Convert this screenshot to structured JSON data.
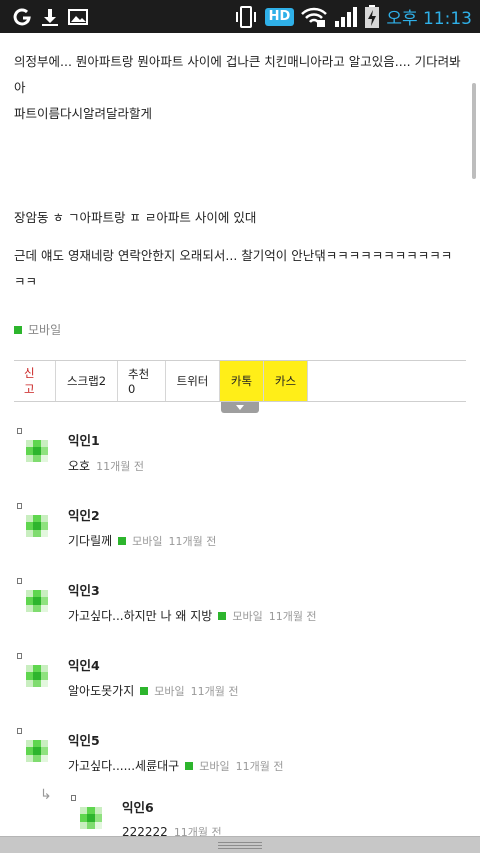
{
  "status_bar": {
    "clock": "오후 11:13",
    "hd_badge": "HD",
    "icons": [
      "app-icon",
      "download-icon",
      "image-icon",
      "vibrate-icon",
      "wifi-icon",
      "signal-icon",
      "battery-charging-icon"
    ]
  },
  "post": {
    "line1": "의정부에... 뭔아파트랑 뭔아파트 사이에 겁나큰 치킨매니아라고 알고있음.... 기다려봐 아",
    "line2": "파트이름다시알려달라할게",
    "line3": "장암동 ㅎ ㄱ아파트랑 ㅍ ㄹ아파트 사이에 있대",
    "line4": "근데 얘도 영재네랑 연락안한지 오래되서... 찰기억이 안난댂ㅋㅋㅋㅋㅋㅋㅋㅋㅋㅋㅋ",
    "line5": "ㅋㅋ",
    "source": "모바일"
  },
  "actions": {
    "report": "신고",
    "scrap": "스크랩2",
    "recommend": "추천0",
    "twitter": "트위터",
    "katalk": "카톡",
    "kastory": "카스"
  },
  "comments": [
    {
      "name": "익인1",
      "text": "오호",
      "source": "",
      "time": "11개월 전"
    },
    {
      "name": "익인2",
      "text": "기다릴께",
      "source": "모바일",
      "time": "11개월 전"
    },
    {
      "name": "익인3",
      "text": "가고싶다...하지만 나 왜 지방",
      "source": "모바일",
      "time": "11개월 전"
    },
    {
      "name": "익인4",
      "text": "알아도못가지",
      "source": "모바일",
      "time": "11개월 전"
    },
    {
      "name": "익인5",
      "text": "가고싶다......세륜대구",
      "source": "모바일",
      "time": "11개월 전"
    },
    {
      "name": "익인6",
      "text": "222222",
      "source": "",
      "time": "11개월 전"
    }
  ],
  "colors": {
    "accent_blue": "#2fb0e8",
    "mobile_green": "#2db52d",
    "report_red": "#c81e1e",
    "share_yellow": "#ffee18"
  }
}
